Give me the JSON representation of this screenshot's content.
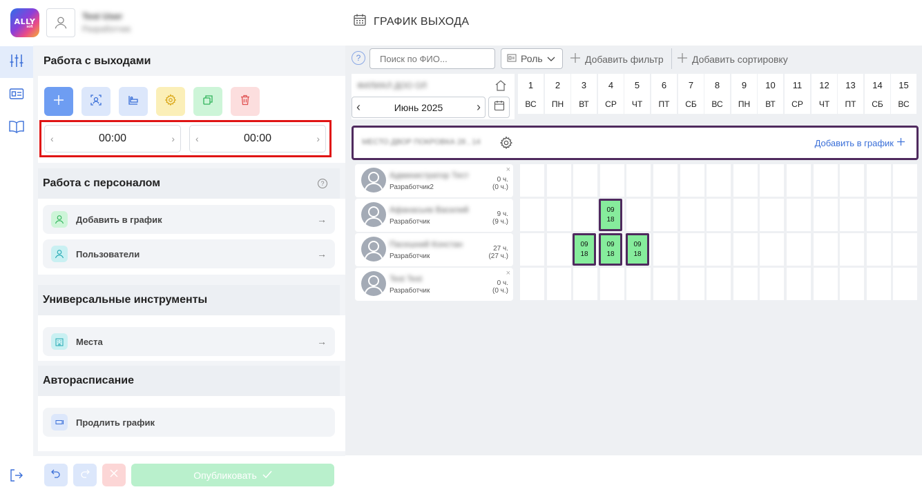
{
  "header": {
    "logo_text": "ALLY",
    "logo_sub": "soft",
    "user_name": "Test User",
    "user_role": "Разработчик",
    "page_title": "ГРАФИК ВЫХОДА"
  },
  "panel": {
    "section1_title": "Работа с выходами",
    "time_start": "00:00",
    "time_end": "00:00",
    "section2_title": "Работа с персоналом",
    "item_add_to_schedule": "Добавить в график",
    "item_users": "Пользователи",
    "section3_title": "Универсальные инструменты",
    "item_places": "Места",
    "section4_title": "Авторасписание",
    "item_extend": "Продлить график",
    "publish_label": "Опубликовать"
  },
  "toolbar": {
    "help": "?",
    "search_placeholder": "Поиск по ФИО...",
    "role_label": "Роль",
    "add_filter": "Добавить фильтр",
    "add_sort": "Добавить сортировку"
  },
  "calendar": {
    "org_name": "ФИЛИАЛ ДОО ОЛ",
    "month": "Июнь 2025",
    "days": [
      {
        "n": "1",
        "w": "ВС"
      },
      {
        "n": "2",
        "w": "ПН"
      },
      {
        "n": "3",
        "w": "ВТ"
      },
      {
        "n": "4",
        "w": "СР"
      },
      {
        "n": "5",
        "w": "ЧТ"
      },
      {
        "n": "6",
        "w": "ПТ"
      },
      {
        "n": "7",
        "w": "СБ"
      },
      {
        "n": "8",
        "w": "ВС"
      },
      {
        "n": "9",
        "w": "ПН"
      },
      {
        "n": "10",
        "w": "ВТ"
      },
      {
        "n": "11",
        "w": "СР"
      },
      {
        "n": "12",
        "w": "ЧТ"
      },
      {
        "n": "13",
        "w": "ПТ"
      },
      {
        "n": "14",
        "w": "СБ"
      },
      {
        "n": "15",
        "w": "ВС"
      }
    ],
    "place_name": "МЕСТО ДВОР ПОКРОВКА 28 , 14",
    "add_to_schedule": "Добавить в график"
  },
  "employees": [
    {
      "name": "Администратор Тест",
      "role": "Разработчик2",
      "hours": "0 ч.",
      "hours_sub": "(0 ч.)",
      "removable": true,
      "shifts": []
    },
    {
      "name": "Афанасьев Василий",
      "role": "Разработчик",
      "hours": "9 ч.",
      "hours_sub": "(9 ч.)",
      "removable": false,
      "shifts": [
        {
          "day": 3,
          "start": "09",
          "end": "18"
        }
      ]
    },
    {
      "name": "Пасешний Констан",
      "role": "Разработчик",
      "hours": "27 ч.",
      "hours_sub": "(27 ч.)",
      "removable": false,
      "shifts": [
        {
          "day": 2,
          "start": "09",
          "end": "18"
        },
        {
          "day": 3,
          "start": "09",
          "end": "18"
        },
        {
          "day": 4,
          "start": "09",
          "end": "18"
        }
      ]
    },
    {
      "name": "Test Test",
      "role": "Разработчик",
      "hours": "0 ч.",
      "hours_sub": "(0 ч.)",
      "removable": true,
      "shifts": []
    }
  ],
  "colors": {
    "accent": "#3a6fd8",
    "highlight": "#e01414",
    "shift_fill": "#86ec9c",
    "shift_border": "#4f2a5e"
  }
}
